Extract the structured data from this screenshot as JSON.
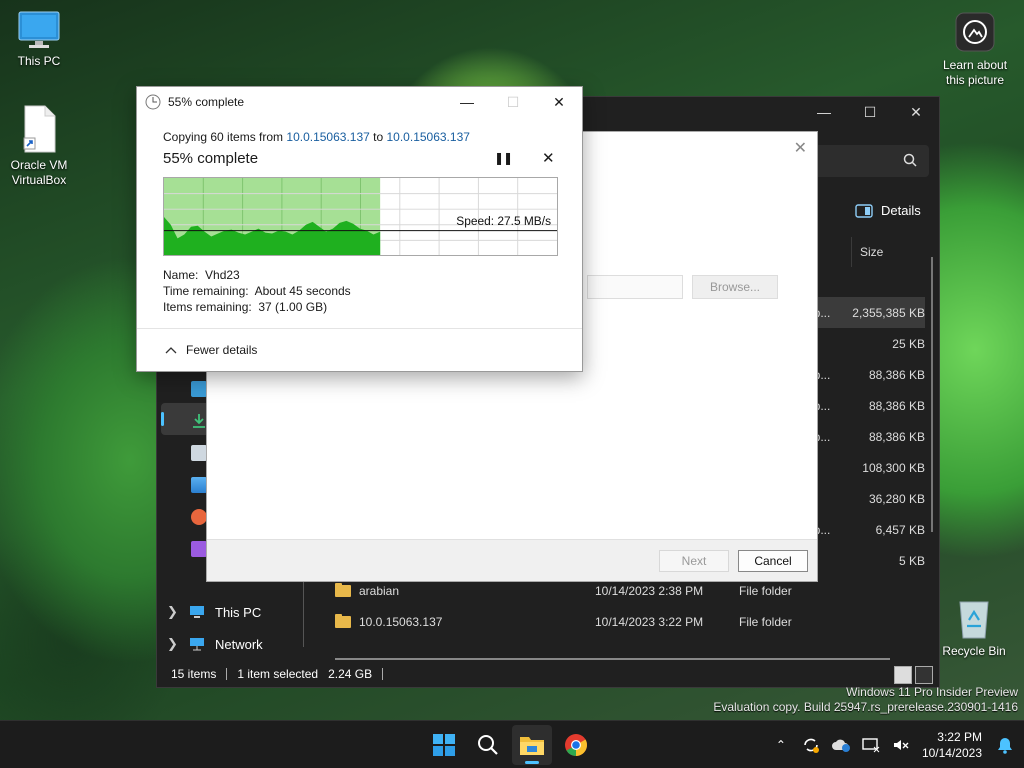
{
  "desktop": {
    "this_pc": "This PC",
    "virtualbox": "Oracle VM VirtualBox",
    "learn": "Learn about this picture",
    "recycle_bin": "Recycle Bin",
    "watermark_line1": "Windows 11 Pro Insider Preview",
    "watermark_line2": "Evaluation copy. Build 25947.rs_prerelease.230901-1416"
  },
  "explorer": {
    "details_label": "Details",
    "size_header": "Size",
    "sizes": [
      {
        "prefix": "pp...",
        "size": "2,355,385 KB",
        "selected": true
      },
      {
        "prefix": "",
        "size": "25 KB",
        "selected": false
      },
      {
        "prefix": "pp...",
        "size": "88,386 KB",
        "selected": false
      },
      {
        "prefix": "pp...",
        "size": "88,386 KB",
        "selected": false
      },
      {
        "prefix": "pp...",
        "size": "88,386 KB",
        "selected": false
      },
      {
        "prefix": "",
        "size": "108,300 KB",
        "selected": false
      },
      {
        "prefix": "",
        "size": "36,280 KB",
        "selected": false
      },
      {
        "prefix": "pp...",
        "size": "6,457 KB",
        "selected": false
      },
      {
        "prefix": "",
        "size": "5 KB",
        "selected": false
      }
    ],
    "tree": {
      "this_pc": "This PC",
      "network": "Network"
    },
    "files": [
      {
        "name": "arabian",
        "date": "10/14/2023 2:38 PM",
        "type": "File folder"
      },
      {
        "name": "10.0.15063.137",
        "date": "10/14/2023 3:22 PM",
        "type": "File folder"
      }
    ],
    "status": {
      "items": "15 items",
      "selected": "1 item selected",
      "size": "2.24 GB"
    }
  },
  "wizard": {
    "browse": "Browse...",
    "next": "Next",
    "cancel": "Cancel"
  },
  "copy_dialog": {
    "title": "55% complete",
    "copying_prefix": "Copying 60 items from ",
    "source": "10.0.15063.137",
    "to_word": " to ",
    "destination": "10.0.15063.137",
    "headline": "55% complete",
    "progress": 0.55,
    "speed_label": "Speed: 27.5 MB/s",
    "name_label": "Name:",
    "name_value": "Vhd23",
    "time_label": "Time remaining:",
    "time_value": "About 45 seconds",
    "items_label": "Items remaining:",
    "items_value": "37 (1.00 GB)",
    "fewer_details": "Fewer details",
    "colors": {
      "fill": "#a6e095",
      "graph": "#1fb01f"
    }
  },
  "taskbar": {
    "time": "3:22 PM",
    "date": "10/14/2023",
    "accent": "#4cc2ff"
  }
}
